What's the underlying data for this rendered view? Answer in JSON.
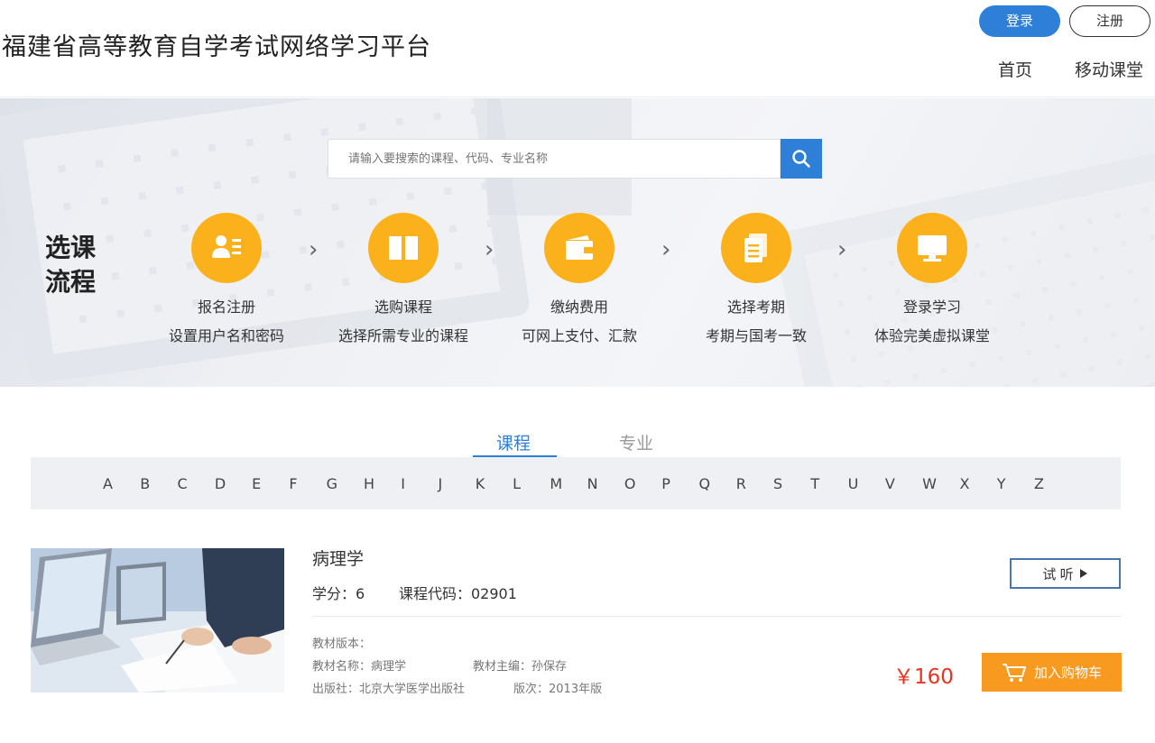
{
  "header": {
    "title": "福建省高等教育自学考试网络学习平台",
    "login_label": "登录",
    "register_label": "注册",
    "nav": [
      "首页",
      "移动课堂"
    ]
  },
  "search": {
    "placeholder": "请输入要搜索的课程、代码、专业名称",
    "icon": "search-icon"
  },
  "flow": {
    "title_line1": "选课",
    "title_line2": "流程",
    "arrow": "›",
    "steps": [
      {
        "name": "报名注册",
        "desc": "设置用户名和密码",
        "icon": "user-card-icon"
      },
      {
        "name": "选购课程",
        "desc": "选择所需专业的课程",
        "icon": "book-icon"
      },
      {
        "name": "缴纳费用",
        "desc": "可网上支付、汇款",
        "icon": "wallet-icon"
      },
      {
        "name": "选择考期",
        "desc": "考期与国考一致",
        "icon": "document-icon"
      },
      {
        "name": "登录学习",
        "desc": "体验完美虚拟课堂",
        "icon": "monitor-icon"
      }
    ]
  },
  "tabs": [
    {
      "label": "课程",
      "active": true
    },
    {
      "label": "专业",
      "active": false
    }
  ],
  "alphabet": [
    "A",
    "B",
    "C",
    "D",
    "E",
    "F",
    "G",
    "H",
    "I",
    "J",
    "K",
    "L",
    "M",
    "N",
    "O",
    "P",
    "Q",
    "R",
    "S",
    "T",
    "U",
    "V",
    "W",
    "X",
    "Y",
    "Z"
  ],
  "course": {
    "name": "病理学",
    "credit": "学分：6",
    "code": "课程代码：02901",
    "textbook_version": "教材版本：",
    "textbook_name": "教材名称：病理学",
    "editor": "教材主编：孙保存",
    "publisher": "出版社：北京大学医学出版社",
    "edition": "版次：2013年版",
    "price": "￥160",
    "trial_label": "试 听",
    "cart_label": "加入购物车"
  },
  "colors": {
    "primary": "#2d7fd8",
    "step_circle": "#fbb11c",
    "price": "#e8341f",
    "cart_button": "#f89a20"
  }
}
